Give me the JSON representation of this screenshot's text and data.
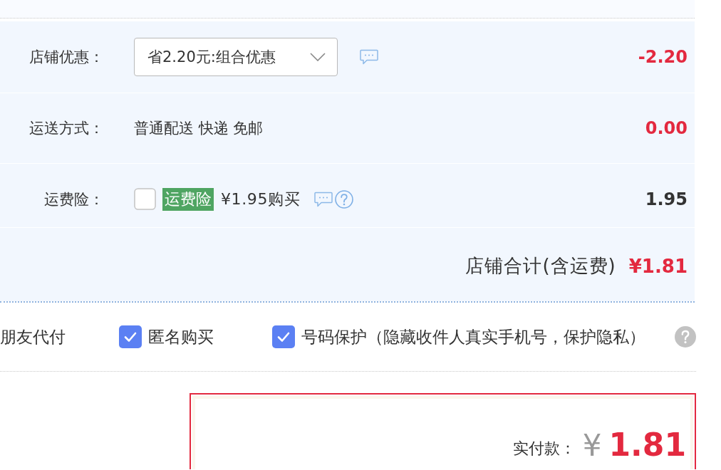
{
  "shop_rows": [
    {
      "kind": "coupon",
      "label": "店铺优惠：",
      "select_value": "省2.20元:组合优惠",
      "amount": "-2.20",
      "emphasized": true
    },
    {
      "kind": "text",
      "label": "运送方式：",
      "value": "普通配送 快递 免邮",
      "amount": "0.00",
      "emphasized": true
    },
    {
      "kind": "insurance",
      "label": "运费险：",
      "checked": false,
      "tag": "运费险",
      "price": "¥1.95购买",
      "amount": "1.95",
      "emphasized": false
    }
  ],
  "shop_total": {
    "label": "店铺合计(含运费)",
    "amount": "¥1.81"
  },
  "options": [
    {
      "kind": "text",
      "label": "朋友代付"
    },
    {
      "kind": "checkbox",
      "label": "匿名购买",
      "checked": true
    },
    {
      "kind": "checkbox",
      "label": "号码保护（隐藏收件人真实手机号，保护隐私）",
      "checked": true,
      "help": true
    }
  ],
  "payment": {
    "label": "实付款：",
    "currency": "¥",
    "amount": "1.81"
  }
}
